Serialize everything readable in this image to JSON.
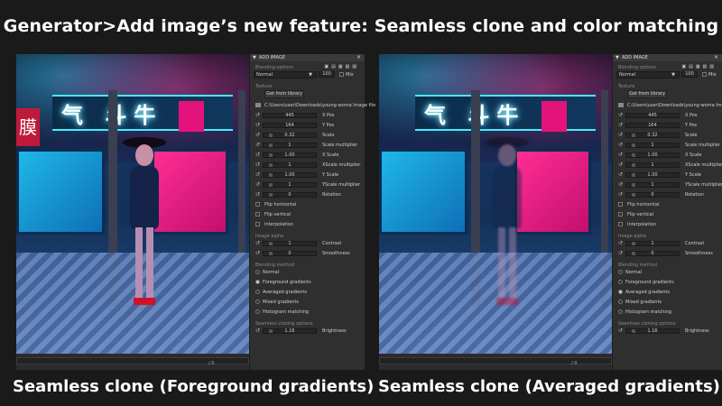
{
  "headline": "Generator>Add image’s new feature: Seamless clone and color matching",
  "captions": {
    "left": "Seamless clone (Foreground gradients)",
    "right": "Seamless clone (Averaged gradients)"
  },
  "scene": {
    "glyphs": "气 斗牛",
    "red_sign": "膜",
    "scroll_count": "/ 0"
  },
  "panel": {
    "title": "ADD IMAGE",
    "blending_options": "Blending options",
    "blend_mode": "Normal",
    "opacity": "100",
    "mix_label": "Mix",
    "texture": "Texture",
    "get_from_library": "Get from library",
    "file_path": "C:\\Users\\user\\Downloads\\young-woma Image file",
    "x_pos": "445",
    "x_pos_label": "X Pos",
    "y_pos": "164",
    "y_pos_label": "Y Pos",
    "scale": "0.32",
    "scale_label": "Scale",
    "scale_mult": "1",
    "scale_mult_label": "Scale multiplier",
    "x_scale": "1.00",
    "x_scale_label": "X Scale",
    "x_scale_mult": "1",
    "x_scale_mult_label": "XScale multiplier",
    "y_scale": "1.00",
    "y_scale_label": "Y Scale",
    "y_scale_mult": "1",
    "y_scale_mult_label": "YScale multiplier",
    "rotation": "0",
    "rotation_label": "Rotation",
    "flip_h": "Flip horizontal",
    "flip_v": "Flip vertical",
    "interpolation": "Interpolation",
    "image_alpha": "Image alpha",
    "contrast": "1",
    "contrast_label": "Contrast",
    "smoothness": "0",
    "smoothness_label": "Smoothness",
    "blending_method": "Blending method",
    "methods": [
      "Normal",
      "Foreground gradients",
      "Averaged gradients",
      "Mixed gradients",
      "Histogram matching"
    ],
    "seamless_options": "Seamless cloning options",
    "brightness": "1.16",
    "brightness_label": "Brightness"
  },
  "selected_method": {
    "left": "Foreground gradients",
    "right": "Averaged gradients"
  }
}
